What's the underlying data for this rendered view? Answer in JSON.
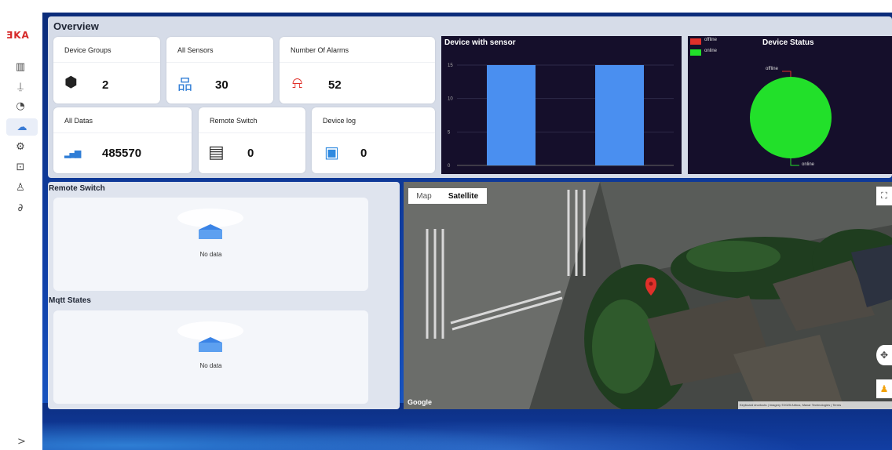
{
  "brand": {
    "logo_text": "ƎKA"
  },
  "sidebar": {
    "items": [
      {
        "icon": "bar-chart-icon",
        "glyph": "▥"
      },
      {
        "icon": "alarm-icon",
        "glyph": "⍊"
      },
      {
        "icon": "pie-chart-icon",
        "glyph": "◔"
      },
      {
        "icon": "cloud-icon",
        "glyph": "☁"
      },
      {
        "icon": "settings-icon",
        "glyph": "⚙"
      },
      {
        "icon": "report-icon",
        "glyph": "⊡"
      },
      {
        "icon": "user-icon",
        "glyph": "♙"
      },
      {
        "icon": "link-icon",
        "glyph": "∂"
      }
    ],
    "collapse_glyph": ">"
  },
  "overview": {
    "title": "Overview",
    "cards": [
      {
        "label": "Device Groups",
        "value": "2",
        "icon": "cube-icon",
        "glyph": "⬢"
      },
      {
        "label": "All Sensors",
        "value": "30",
        "icon": "network-icon",
        "glyph": "品"
      },
      {
        "label": "Number Of Alarms",
        "value": "52",
        "icon": "siren-icon",
        "glyph": "⍾"
      },
      {
        "label": "All Datas",
        "value": "485570",
        "icon": "data-bars-icon",
        "glyph": "▂▄▆"
      },
      {
        "label": "Remote Switch",
        "value": "0",
        "icon": "server-clock-icon",
        "glyph": "▤"
      },
      {
        "label": "Device log",
        "value": "0",
        "icon": "clipboard-icon",
        "glyph": "▣"
      }
    ]
  },
  "device_chart": {
    "title": "Device with sensor",
    "chart_data": {
      "type": "bar",
      "categories": [
        "",
        ""
      ],
      "values": [
        15,
        15
      ],
      "ylim": [
        0,
        15
      ],
      "yticks": [
        "0",
        "5",
        "10",
        "15"
      ],
      "color": "#4a8ff0"
    }
  },
  "status_chart": {
    "title": "Device Status",
    "legend": [
      {
        "name": "offline",
        "color": "#e0302a"
      },
      {
        "name": "online",
        "color": "#22e02a"
      }
    ],
    "labels": {
      "offline": "offline",
      "online": "online"
    },
    "chart_data": {
      "type": "pie",
      "categories": [
        "offline",
        "online"
      ],
      "values": [
        0,
        1
      ],
      "colors": [
        "#e0302a",
        "#22e02a"
      ]
    }
  },
  "remote_switch": {
    "title": "Remote Switch",
    "empty_text": "No data"
  },
  "mqtt_states": {
    "title": "Mqtt States",
    "empty_text": "No data"
  },
  "map": {
    "tab_map": "Map",
    "tab_satellite": "Satellite",
    "google_label": "Google",
    "attribution": "Keyboard shortcuts  |  Imagery ©2025 Airbus, Maxar Technologies  |  Terms"
  }
}
